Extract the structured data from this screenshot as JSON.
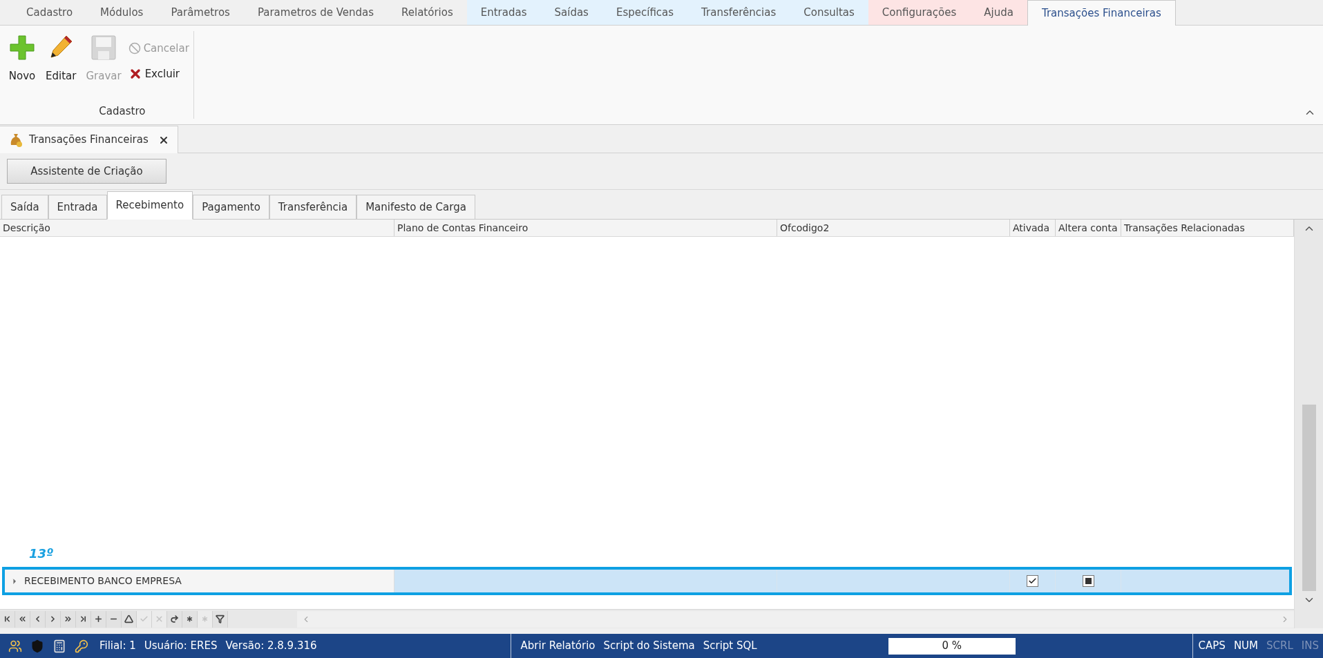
{
  "menu_tabs": [
    {
      "label": "Cadastro",
      "selected": false,
      "color": "#f0f0f0"
    },
    {
      "label": "Módulos",
      "selected": false,
      "color": "#f0f0f0"
    },
    {
      "label": "Parâmetros",
      "selected": false,
      "color": "#f0f0f0"
    },
    {
      "label": "Parametros de Vendas",
      "selected": false,
      "color": "#f0f0f0"
    },
    {
      "label": "Relatórios",
      "selected": false,
      "color": "#f0f0f0"
    },
    {
      "label": "Entradas",
      "selected": false,
      "color": "#e3f2fd"
    },
    {
      "label": "Saídas",
      "selected": false,
      "color": "#e3f2fd"
    },
    {
      "label": "Específicas",
      "selected": false,
      "color": "#e3f2fd"
    },
    {
      "label": "Transferências",
      "selected": false,
      "color": "#e3f2fd"
    },
    {
      "label": "Consultas",
      "selected": false,
      "color": "#e3f2fd"
    },
    {
      "label": "Configurações",
      "selected": false,
      "color": "#fde4e4"
    },
    {
      "label": "Ajuda",
      "selected": false,
      "color": "#fde4e4"
    },
    {
      "label": "Transações Financeiras",
      "selected": true,
      "color": "#f9f9f9"
    }
  ],
  "ribbon": {
    "group_label": "Cadastro",
    "large_buttons": [
      {
        "kind": "new",
        "label": "Novo",
        "disabled": false
      },
      {
        "kind": "edit",
        "label": "Editar",
        "disabled": false
      },
      {
        "kind": "save",
        "label": "Gravar",
        "disabled": true
      }
    ],
    "small_buttons": [
      {
        "kind": "cancel",
        "label": "Cancelar",
        "disabled": true
      },
      {
        "kind": "delete",
        "label": "Excluir",
        "disabled": false
      }
    ]
  },
  "document_tab": {
    "title": "Transações Financeiras"
  },
  "wizard_button": "Assistente de Criação",
  "tabs": [
    {
      "label": "Saída",
      "selected": false
    },
    {
      "label": "Entrada",
      "selected": false
    },
    {
      "label": "Recebimento",
      "selected": true
    },
    {
      "label": "Pagamento",
      "selected": false
    },
    {
      "label": "Transferência",
      "selected": false
    },
    {
      "label": "Manifesto de Carga",
      "selected": false
    }
  ],
  "table": {
    "columns": [
      "Descrição",
      "Plano de Contas Financeiro",
      "Ofcodigo2",
      "Ativada",
      "Altera conta",
      "Transações Relacionadas"
    ],
    "rows": [
      {
        "descricao": "RECEBIMENTO BANCO EMPRESA",
        "selected": true,
        "highlighted": true,
        "ativada": true,
        "altera_conta_mixed": true
      }
    ]
  },
  "annotation": {
    "label": "13º"
  },
  "navigator": [
    {
      "kind": "first",
      "disabled": false
    },
    {
      "kind": "prev-page",
      "disabled": false
    },
    {
      "kind": "prev",
      "disabled": false
    },
    {
      "kind": "next",
      "disabled": false
    },
    {
      "kind": "next-page",
      "disabled": false
    },
    {
      "kind": "last",
      "disabled": false
    },
    {
      "kind": "insert",
      "disabled": false
    },
    {
      "kind": "delete",
      "disabled": false
    },
    {
      "kind": "edit",
      "disabled": false
    },
    {
      "kind": "post",
      "disabled": true
    },
    {
      "kind": "cancel",
      "disabled": true
    },
    {
      "kind": "refresh",
      "disabled": false
    },
    {
      "kind": "bookmark",
      "disabled": false
    },
    {
      "kind": "goto-bookmark",
      "disabled": true
    },
    {
      "kind": "filter",
      "disabled": false
    }
  ],
  "status_bar": {
    "info": [
      "Filial: 1",
      "Usuário: ERES",
      "Versão: 2.8.9.316"
    ],
    "actions": [
      "Abrir Relatório",
      "Script do Sistema",
      "Script SQL"
    ],
    "progress": {
      "level": 0,
      "reading": "0 %"
    },
    "keys": [
      {
        "label": "CAPS",
        "on": true
      },
      {
        "label": "NUM",
        "on": true
      },
      {
        "label": "SCRL",
        "on": false
      },
      {
        "label": "INS",
        "on": false
      }
    ]
  }
}
